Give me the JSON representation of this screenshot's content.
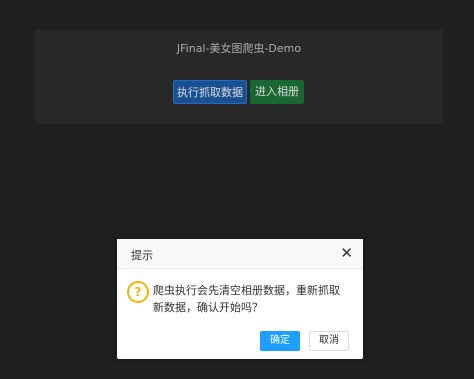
{
  "panel": {
    "title": "JFinal-美女图爬虫-Demo",
    "crawl_button": "执行抓取数据",
    "album_button": "进入相册"
  },
  "dialog": {
    "title": "提示",
    "close_icon": "close-icon",
    "warning_icon": "question-icon",
    "message": "爬虫执行会先清空相册数据，重新抓取新数据，确认开始吗？",
    "ok_label": "确定",
    "cancel_label": "取消"
  },
  "colors": {
    "background": "#262626",
    "panel": "#2f2f2f",
    "primary": "#1e5fae",
    "success": "#1f7a3c",
    "ok": "#1e9fff",
    "warning": "#f3b400"
  }
}
